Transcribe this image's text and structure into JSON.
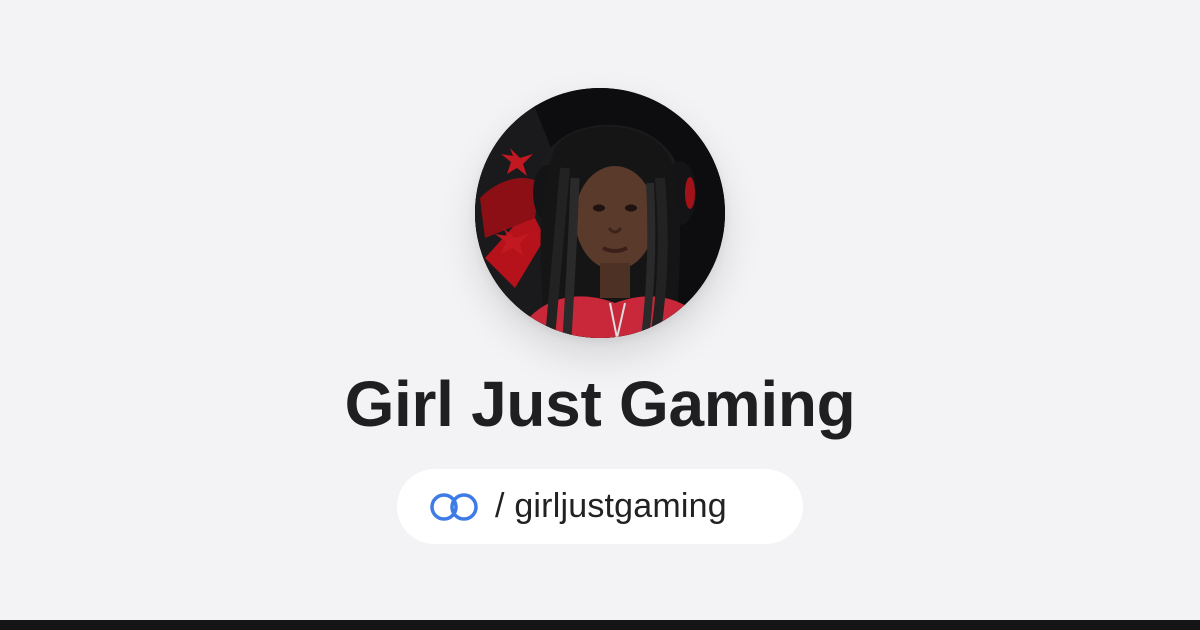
{
  "profile": {
    "name": "Girl Just Gaming",
    "handle_prefix": "/",
    "handle": "girljustgaming",
    "avatar_alt": "Profile photo",
    "logo_icon": "linked-rings-icon"
  },
  "colors": {
    "background": "#f3f3f5",
    "logo_blue": "#3f7be6",
    "title": "#1f1f22",
    "bottom_bar": "#151515"
  }
}
